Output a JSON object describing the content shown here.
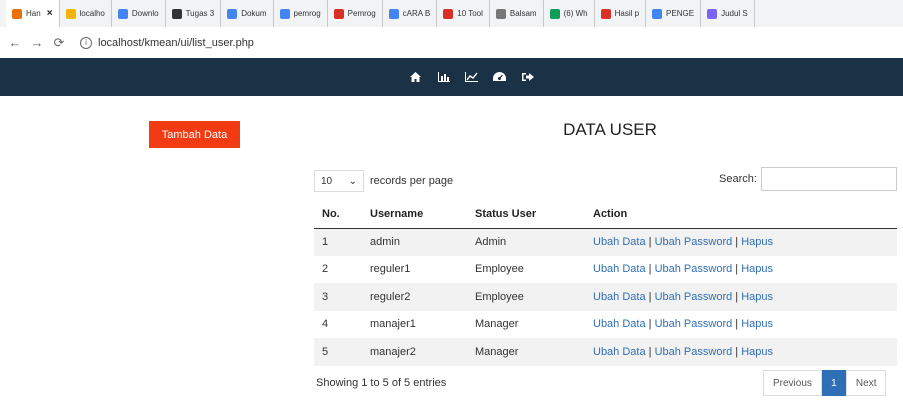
{
  "browser": {
    "tabs": [
      {
        "label": "Han",
        "icon": "orange",
        "active": true
      },
      {
        "label": "localho",
        "icon": "yellow"
      },
      {
        "label": "Downlo",
        "icon": "blue"
      },
      {
        "label": "Tugas 3",
        "icon": "dark"
      },
      {
        "label": "Dokum",
        "icon": "blue"
      },
      {
        "label": "pemrog",
        "icon": "google"
      },
      {
        "label": "Pemrog",
        "icon": "red"
      },
      {
        "label": "cARA B",
        "icon": "google"
      },
      {
        "label": "10 Tool",
        "icon": "red"
      },
      {
        "label": "Balsam",
        "icon": "gray"
      },
      {
        "label": "(6) Wh",
        "icon": "green"
      },
      {
        "label": "Hasil p",
        "icon": "gmail"
      },
      {
        "label": "PENGE",
        "icon": "google"
      },
      {
        "label": "Judul S",
        "icon": "purple"
      }
    ],
    "url": "localhost/kmean/ui/list_user.php"
  },
  "navbar": {
    "icons": [
      "home-icon",
      "bar-chart-icon",
      "line-chart-icon",
      "dashboard-icon",
      "sign-out-icon"
    ]
  },
  "page": {
    "add_button": "Tambah Data",
    "title": "DATA USER",
    "length_value": "10",
    "length_label": "records per page",
    "search_label": "Search:",
    "columns": [
      "No.",
      "Username",
      "Status User",
      "Action"
    ],
    "rows": [
      {
        "no": "1",
        "username": "admin",
        "status": "Admin"
      },
      {
        "no": "2",
        "username": "reguler1",
        "status": "Employee"
      },
      {
        "no": "3",
        "username": "reguler2",
        "status": "Employee"
      },
      {
        "no": "4",
        "username": "manajer1",
        "status": "Manager"
      },
      {
        "no": "5",
        "username": "manajer2",
        "status": "Manager"
      }
    ],
    "actions": {
      "edit": "Ubah Data",
      "password": "Ubah Password",
      "delete": "Hapus"
    },
    "info": "Showing 1 to 5 of 5 entries",
    "pagination": {
      "previous": "Previous",
      "current": "1",
      "next": "Next"
    }
  },
  "colors": {
    "navbar": "#1a3146",
    "add_button": "#f23b13",
    "link": "#2f6fb5"
  }
}
